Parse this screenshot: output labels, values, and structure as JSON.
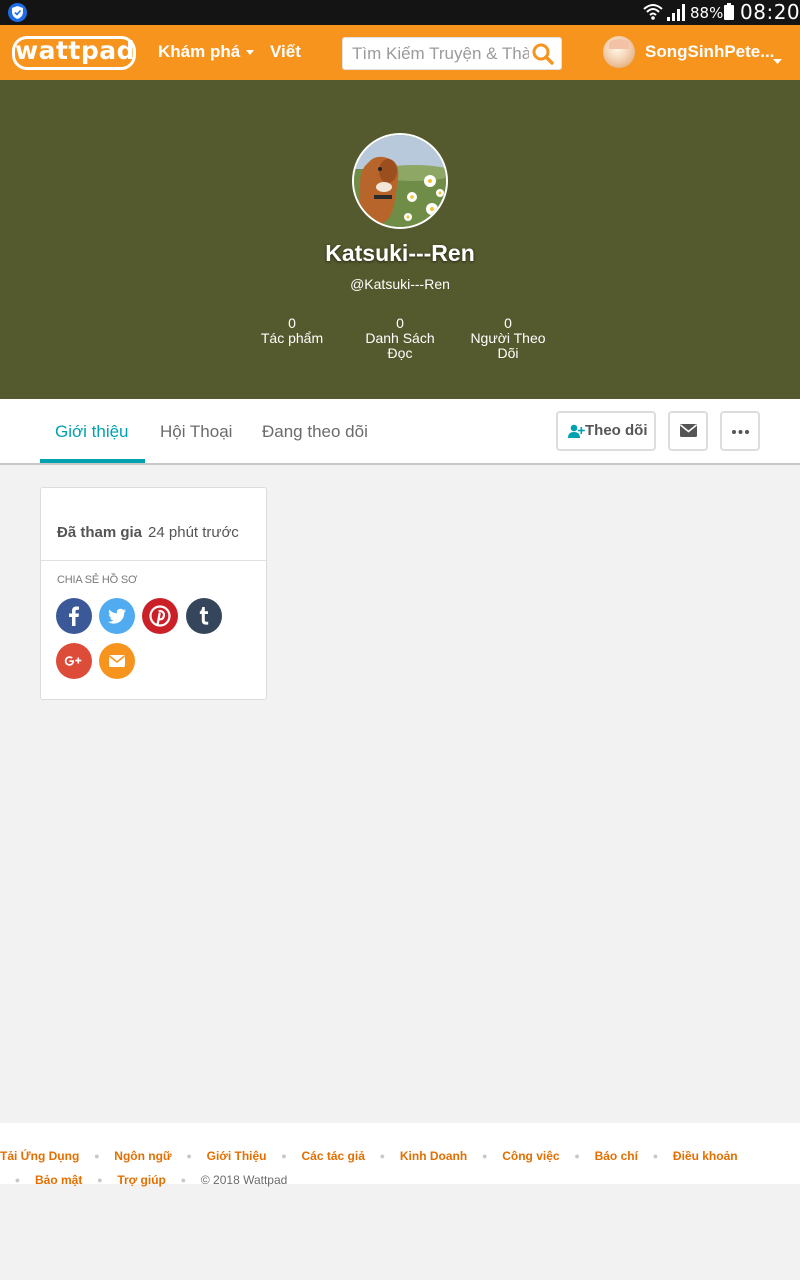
{
  "status_bar": {
    "battery_percent": "88%",
    "time": "08:20",
    "icons": [
      "shield-icon",
      "wifi-icon",
      "signal-icon",
      "battery-icon"
    ]
  },
  "header": {
    "logo": "wattpad",
    "nav_discover": "Khám phá",
    "nav_write": "Viết",
    "search_placeholder": "Tìm Kiếm Truyện & Thành viên",
    "user_name": "SongSinhPete...",
    "colors": {
      "brand": "#f7941e"
    }
  },
  "profile": {
    "name": "Katsuki---Ren",
    "handle": "@Katsuki---Ren",
    "banner_color": "#555a2e",
    "stats": [
      {
        "value": "0",
        "label": "Tác phẩm"
      },
      {
        "value": "0",
        "label": "Danh Sách Đọc"
      },
      {
        "value": "0",
        "label": "Người Theo Dõi"
      }
    ]
  },
  "tabs": {
    "items": [
      {
        "label": "Giới thiệu",
        "active": true
      },
      {
        "label": "Hội Thoại",
        "active": false
      },
      {
        "label": "Đang theo dõi",
        "active": false
      }
    ],
    "follow_button": "Theo dõi",
    "accent": "#00a1ae"
  },
  "about": {
    "joined_label": "Đã tham gia",
    "joined_value": "24 phút trước",
    "share_label": "CHIA SẺ HỒ SƠ",
    "social": [
      "facebook-icon",
      "twitter-icon",
      "pinterest-icon",
      "tumblr-icon",
      "google-plus-icon",
      "email-icon"
    ]
  },
  "footer": {
    "links_row1": [
      "Tải Ứng Dụng",
      "Ngôn ngữ",
      "Giới Thiệu",
      "Các tác giả",
      "Kinh Doanh",
      "Công việc",
      "Báo chí",
      "Điều khoản"
    ],
    "links_row2": [
      "Bảo mật",
      "Trợ giúp"
    ],
    "copyright": "© 2018 Wattpad"
  }
}
